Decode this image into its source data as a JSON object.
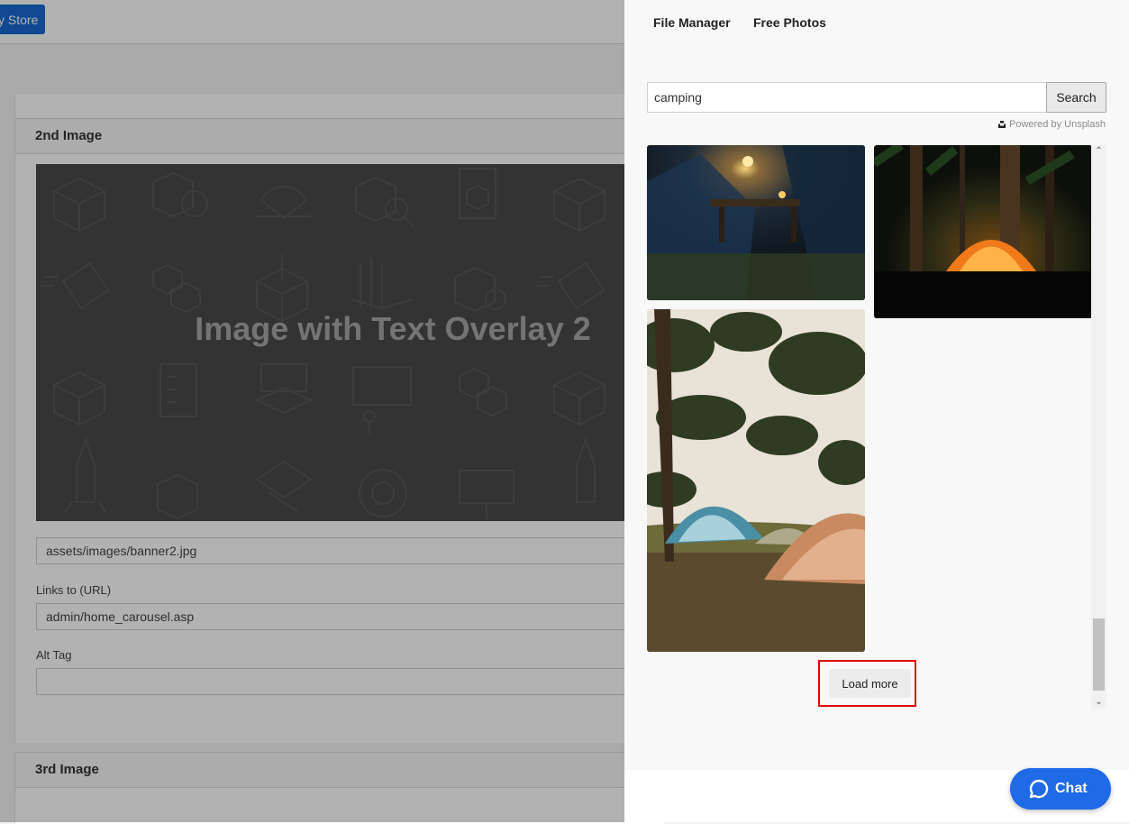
{
  "background_page": {
    "store_button_label": "y Store",
    "section_2_title": "2nd Image",
    "preview_overlay_text": "Image with Text Overlay 2",
    "image_path_value": "assets/images/banner2.jpg",
    "link_label": "Links to (URL)",
    "link_value": "admin/home_carousel.asp",
    "alt_tag_label": "Alt Tag",
    "alt_tag_value": "",
    "section_3_title": "3rd Image"
  },
  "panel": {
    "tabs": [
      {
        "label": "File Manager"
      },
      {
        "label": "Free Photos"
      }
    ],
    "search": {
      "value": "camping",
      "button_label": "Search"
    },
    "powered_by": "Powered by Unsplash",
    "photos": [
      {
        "subject": "campsite-lantern-night"
      },
      {
        "subject": "orange-tent-forest-night"
      },
      {
        "subject": "tents-under-pine-trees"
      }
    ],
    "load_more_label": "Load more"
  },
  "chat": {
    "label": "Chat"
  },
  "colors": {
    "primary_blue": "#1769d1",
    "chat_blue": "#1f6ae6",
    "highlight_red": "#e00000"
  }
}
